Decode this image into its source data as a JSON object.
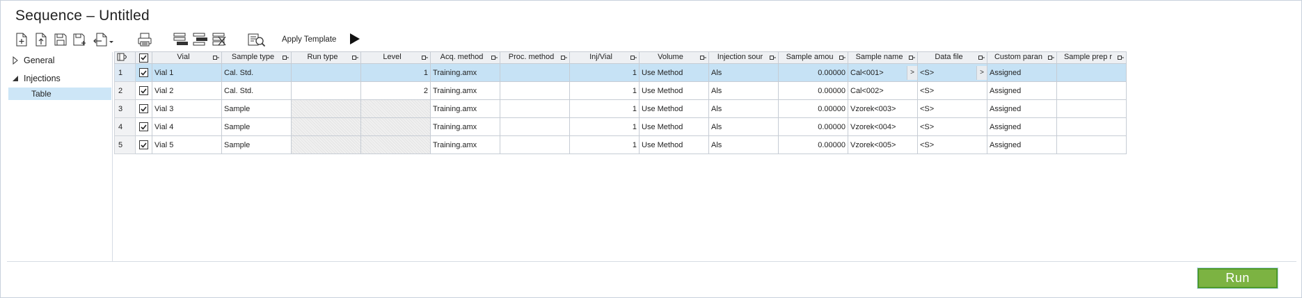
{
  "window": {
    "title": "Sequence – Untitled"
  },
  "toolbar": {
    "icons": [
      "new-icon",
      "import-icon",
      "save-icon",
      "save-as-icon",
      "export-menu-icon",
      "print-icon",
      "insert-row-icon",
      "insert-row-below-icon",
      "delete-row-icon",
      "apply-template-icon"
    ],
    "apply_template_label": "Apply Template",
    "run_label_icon": "play-icon"
  },
  "nav": {
    "items": [
      {
        "label": "General",
        "expanded": false
      },
      {
        "label": "Injections",
        "expanded": true
      }
    ],
    "sub_items": [
      {
        "label": "Table",
        "selected": true
      }
    ]
  },
  "grid": {
    "columns": [
      {
        "label": "Vial"
      },
      {
        "label": "Sample type"
      },
      {
        "label": "Run type"
      },
      {
        "label": "Level"
      },
      {
        "label": "Acq. method"
      },
      {
        "label": "Proc. method"
      },
      {
        "label": "Inj/Vial"
      },
      {
        "label": "Volume"
      },
      {
        "label": "Injection sour"
      },
      {
        "label": "Sample amou"
      },
      {
        "label": "Sample name"
      },
      {
        "label": "Data file"
      },
      {
        "label": "Custom paran"
      },
      {
        "label": "Sample prep r"
      }
    ],
    "rows": [
      {
        "num": "1",
        "checked": true,
        "selected": true,
        "vial": "Vial 1",
        "sample_type": "Cal. Std.",
        "run_type": "",
        "level": "1",
        "acq_method": "Training.amx",
        "proc_method": "",
        "inj_vial": "1",
        "volume": "Use Method",
        "injection_source": "Als",
        "sample_amount": "0.00000",
        "sample_name": "Cal<001>",
        "data_file": "<S>",
        "custom_param": "Assigned",
        "sample_prep": ""
      },
      {
        "num": "2",
        "checked": true,
        "selected": false,
        "vial": "Vial 2",
        "sample_type": "Cal. Std.",
        "run_type": "",
        "level": "2",
        "acq_method": "Training.amx",
        "proc_method": "",
        "inj_vial": "1",
        "volume": "Use Method",
        "injection_source": "Als",
        "sample_amount": "0.00000",
        "sample_name": "Cal<002>",
        "data_file": "<S>",
        "custom_param": "Assigned",
        "sample_prep": ""
      },
      {
        "num": "3",
        "checked": true,
        "selected": false,
        "vial": "Vial 3",
        "sample_type": "Sample",
        "run_type": "",
        "level": "",
        "acq_method": "Training.amx",
        "proc_method": "",
        "inj_vial": "1",
        "volume": "Use Method",
        "injection_source": "Als",
        "sample_amount": "0.00000",
        "sample_name": "Vzorek<003>",
        "data_file": "<S>",
        "custom_param": "Assigned",
        "sample_prep": ""
      },
      {
        "num": "4",
        "checked": true,
        "selected": false,
        "vial": "Vial 4",
        "sample_type": "Sample",
        "run_type": "",
        "level": "",
        "acq_method": "Training.amx",
        "proc_method": "",
        "inj_vial": "1",
        "volume": "Use Method",
        "injection_source": "Als",
        "sample_amount": "0.00000",
        "sample_name": "Vzorek<004>",
        "data_file": "<S>",
        "custom_param": "Assigned",
        "sample_prep": ""
      },
      {
        "num": "5",
        "checked": true,
        "selected": false,
        "vial": "Vial 5",
        "sample_type": "Sample",
        "run_type": "",
        "level": "",
        "acq_method": "Training.amx",
        "proc_method": "",
        "inj_vial": "1",
        "volume": "Use Method",
        "injection_source": "Als",
        "sample_amount": "0.00000",
        "sample_name": "Vzorek<005>",
        "data_file": "<S>",
        "custom_param": "Assigned",
        "sample_prep": ""
      }
    ],
    "expand_glyph": ">"
  },
  "footer": {
    "run_label": "Run"
  },
  "colors": {
    "selection": "#c6e2f5",
    "nav_selection": "#cde6f7",
    "run_button": "#7cb342",
    "run_border": "#4e9a2a"
  }
}
